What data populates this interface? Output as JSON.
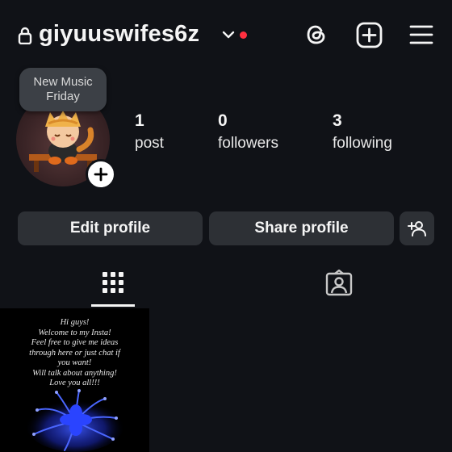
{
  "header": {
    "username": "giyuuswifes6z",
    "notification_color": "#ff3040"
  },
  "note": {
    "lines": [
      "New Music",
      "Friday"
    ]
  },
  "stats": [
    {
      "value": "1",
      "label": "post"
    },
    {
      "value": "0",
      "label": "followers"
    },
    {
      "value": "3",
      "label": "following"
    }
  ],
  "buttons": {
    "edit_profile": "Edit profile",
    "share_profile": "Share profile"
  },
  "tabs": [
    "grid-icon",
    "tagged-icon"
  ],
  "post": {
    "caption_lines": [
      "Hi guys!",
      "Welcome to my Insta!",
      "Feel free to give me ideas",
      "through here or just chat if",
      "you want!",
      "Will talk about anything!",
      "Love you all!!!"
    ],
    "flower_color": "#1f3bff"
  },
  "colors": {
    "background": "#101217",
    "button_bg": "#2d3035",
    "text": "#f5f5f5"
  }
}
